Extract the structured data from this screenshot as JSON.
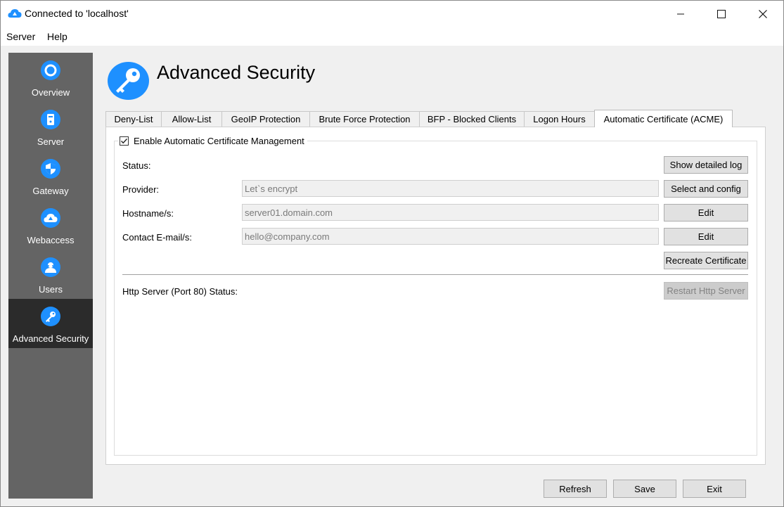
{
  "window": {
    "title": "Connected to 'localhost'",
    "minimize_glyph": "—",
    "maximize_glyph": "☐",
    "close_glyph": "✕"
  },
  "menu": {
    "items": [
      {
        "label": "Server"
      },
      {
        "label": "Help"
      }
    ]
  },
  "sidebar": {
    "items": [
      {
        "label": "Overview",
        "icon": "overview-icon"
      },
      {
        "label": "Server",
        "icon": "server-icon"
      },
      {
        "label": "Gateway",
        "icon": "shield-icon"
      },
      {
        "label": "Webaccess",
        "icon": "cloud-upload-icon"
      },
      {
        "label": "Users",
        "icon": "users-icon"
      },
      {
        "label": "Advanced Security",
        "icon": "key-icon",
        "active": true
      }
    ]
  },
  "header": {
    "title": "Advanced Security",
    "icon": "key-icon",
    "accent_color": "#1e90ff"
  },
  "tabs": [
    {
      "label": "Deny-List"
    },
    {
      "label": "Allow-List"
    },
    {
      "label": "GeoIP Protection"
    },
    {
      "label": "Brute Force Protection"
    },
    {
      "label": "BFP - Blocked Clients"
    },
    {
      "label": "Logon Hours"
    },
    {
      "label": "Automatic Certificate (ACME)",
      "active": true
    }
  ],
  "acme": {
    "enable_label": "Enable Automatic Certificate Management",
    "enabled": true,
    "status_label": "Status:",
    "show_log_button": "Show detailed log",
    "provider_label": "Provider:",
    "provider_value": "Let`s encrypt",
    "select_config_button": "Select and config",
    "hostname_label": "Hostname/s:",
    "hostname_value": "server01.domain.com",
    "hostname_edit_button": "Edit",
    "email_label": "Contact E-mail/s:",
    "email_value": "hello@company.com",
    "email_edit_button": "Edit",
    "recreate_button": "Recreate Certificate",
    "http_status_label": "Http Server (Port 80) Status:",
    "restart_http_button": "Restart Http Server"
  },
  "footer": {
    "refresh_label": "Refresh",
    "save_label": "Save",
    "exit_label": "Exit"
  }
}
